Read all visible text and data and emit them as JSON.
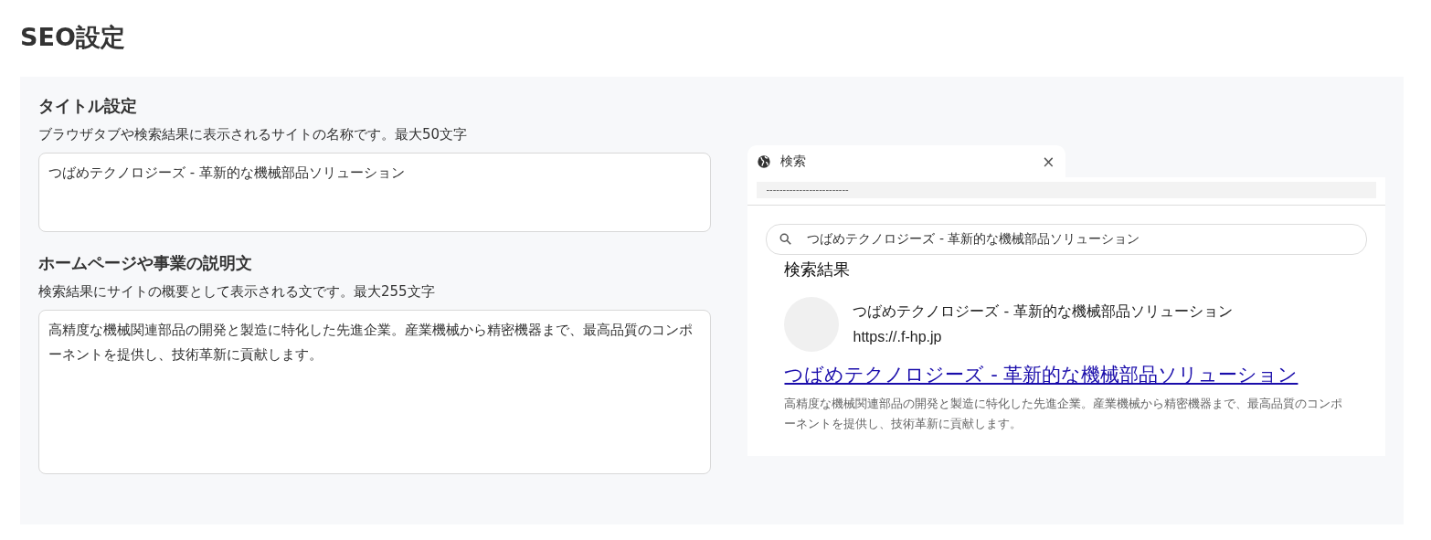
{
  "page_title": "SEO設定",
  "fields": [
    {
      "label": "タイトル設定",
      "hint": "ブラウザタブや検索結果に表示されるサイトの名称です。最大50文字",
      "value": "つばめテクノロジーズ - 革新的な機械部品ソリューション",
      "kind": "short"
    },
    {
      "label": "ホームページや事業の説明文",
      "hint": "検索結果にサイトの概要として表示される文です。最大255文字",
      "value": "高精度な機械関連部品の開発と製造に特化した先進企業。産業機械から精密機器まで、最高品質のコンポーネントを提供し、技術革新に貢献します。",
      "kind": "long"
    }
  ],
  "preview": {
    "tab_title": "検索",
    "tab_close": "×",
    "address": "-------------------------",
    "search_query": "つばめテクノロジーズ - 革新的な機械部品ソリューション",
    "results_heading": "検索結果",
    "site_name": "つばめテクノロジーズ - 革新的な機械部品ソリューション",
    "site_url": "https://.f-hp.jp",
    "result_title": "つばめテクノロジーズ - 革新的な機械部品ソリューション",
    "result_description": "高精度な機械関連部品の開発と製造に特化した先進企業。産業機械から精密機器まで、最高品質のコンポーネントを提供し、技術革新に貢献します。"
  }
}
